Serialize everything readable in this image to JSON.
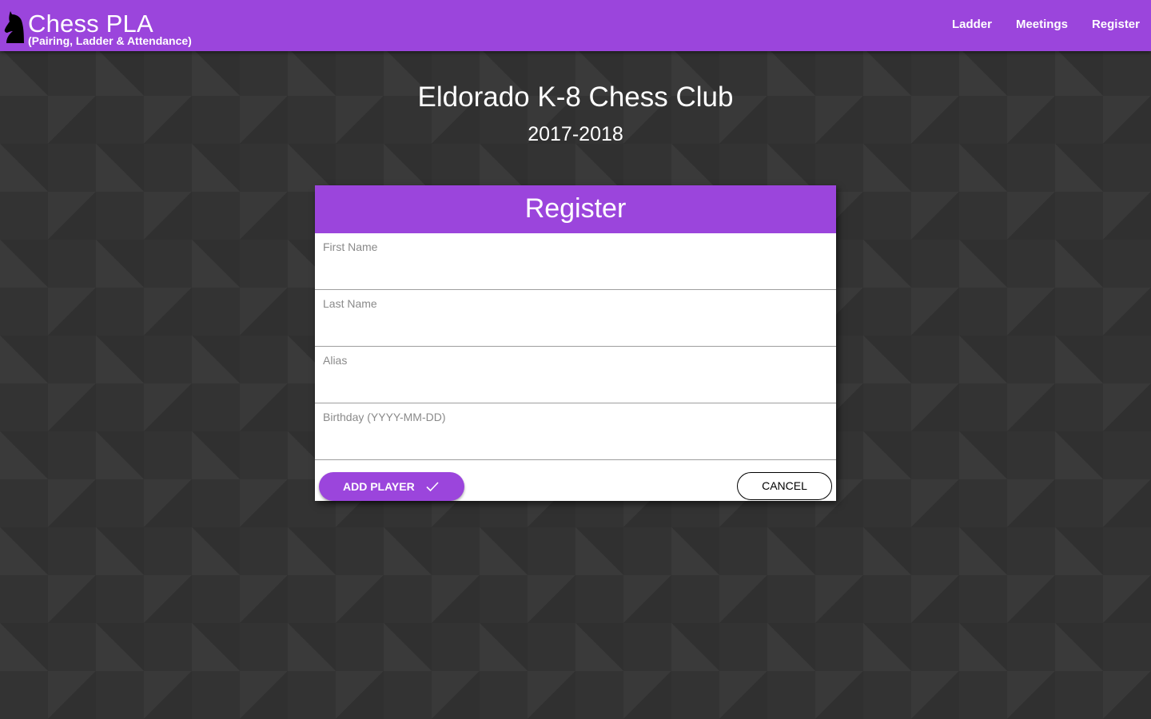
{
  "app": {
    "title": "Chess PLA",
    "subtitle": "(Pairing, Ladder & Attendance)",
    "logo_icon": "chess-knight-icon"
  },
  "nav": {
    "items": [
      {
        "label": "Ladder"
      },
      {
        "label": "Meetings"
      },
      {
        "label": "Register"
      }
    ]
  },
  "page": {
    "club_name": "Eldorado K-8 Chess Club",
    "season": "2017-2018"
  },
  "form": {
    "title": "Register",
    "fields": {
      "first_name": {
        "label": "First Name",
        "value": ""
      },
      "last_name": {
        "label": "Last Name",
        "value": ""
      },
      "alias": {
        "label": "Alias",
        "value": ""
      },
      "birthday": {
        "label": "Birthday (YYYY-MM-DD)",
        "value": ""
      }
    },
    "add_button": {
      "label": "ADD PLAYER",
      "icon": "checkmark-icon"
    },
    "cancel_button": {
      "label": "CANCEL"
    }
  },
  "colors": {
    "accent": "#9b45dc",
    "background": "#333333",
    "card": "#ffffff"
  }
}
